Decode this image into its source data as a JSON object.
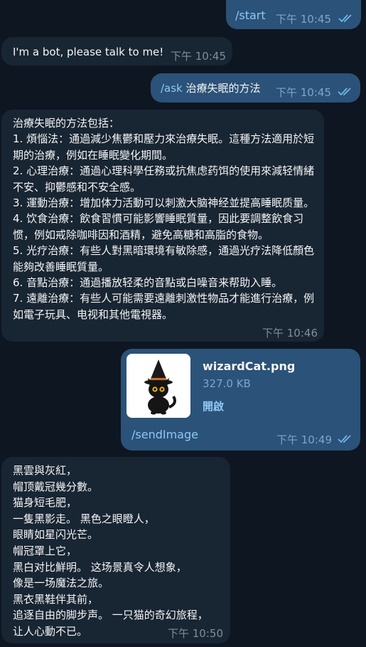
{
  "colors": {
    "background": "#0e1621",
    "outgoing_bubble": "#2b5278",
    "incoming_bubble": "#182533",
    "link": "#8fc8f5",
    "read_check": "#6fb5ea"
  },
  "messages": {
    "start": {
      "text": "/start",
      "time": "下午 10:45"
    },
    "bot_hello": {
      "text": "I'm a bot, please talk to me!",
      "time": "下午 10:45"
    },
    "ask": {
      "command": "/ask",
      "text": " 治療失眠的方法",
      "time": "下午 10:45"
    },
    "answer": {
      "lines": [
        "治療失眠的方法包括：",
        "1. 煩惱法：通過減少焦鬱和壓力來治療失眠。這種方法適用於短期的治療，例如在睡眠變化期間。",
        "2. 心理治療：通過心理科學任務或抗焦虑药饵的使用來減轻情緒不安、抑鬱感和不安全感。",
        "3. 運動治療：增加体力活動可以刺激大脑神经並提高睡眠质量。",
        "4. 饮食治療：飲食習慣可能影響睡眠質量，因此要調整飲食习惯，例如戒除咖啡因和酒精，避免高糖和高脂的食物。",
        "5. 光疗治療：有些人對黑暗環境有敏除感，通過光疗法降低顏色能夠改善睡眠質量。",
        "6. 音點治療：通過播放轻柔的音點或白噪音来帮助入睡。",
        "7. 遠離治療：有些人可能需要遠離刺激性物品才能進行治療，例如電子玩具、电视和其他電視器。"
      ],
      "time": "下午 10:46"
    },
    "image": {
      "file_name": "wizardCat.png",
      "file_size": "327.0 KB",
      "open_label": "開啟",
      "command": "/sendImage",
      "time": "下午 10:49",
      "thumb_icon": "wizard-cat-image"
    },
    "poem": {
      "lines": [
        "黑雲與灰紅，",
        "帽顶戴冠幾分數。",
        "猫身短毛肥，",
        "一隻黑影走。 黑色之眼瞪人，",
        "眼睛如星闪光芒。",
        "帽冠罩上它，",
        "黑白对比鮮明。 这场景真令人想象，",
        "像是一场魔法之旅。",
        "黑衣黑鞋伴其前，",
        "追逐自由的脚步声。 一只猫的奇幻旅程，",
        "让人心動不已。"
      ],
      "time": "下午 10:50"
    }
  }
}
